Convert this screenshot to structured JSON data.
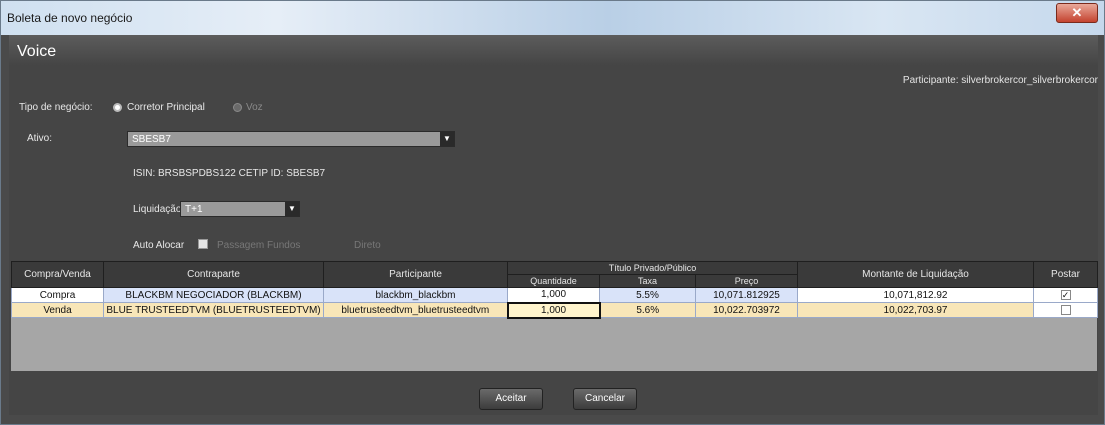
{
  "window": {
    "title": "Boleta de novo negócio",
    "close_glyph": "✕"
  },
  "header": {
    "title": "Voice",
    "participant": "Participante: silverbrokercor_silverbrokercor"
  },
  "form": {
    "deal_type_label": "Tipo de negócio:",
    "deal_type_options": [
      "Corretor Principal",
      "Voz"
    ],
    "deal_type_selected": "Corretor Principal",
    "asset_label": "Ativo:",
    "asset_value": "SBESB7",
    "isin": "ISIN:  BRSBSPDBS122   CETIP ID: SBESB7",
    "settlement_label": "Liquidação:",
    "settlement_value": "T+1",
    "auto_allocate_label": "Auto Alocar",
    "passagem_label": "Passagem Fundos",
    "direto_label": "Direto"
  },
  "table": {
    "headers": {
      "side": "Compra/Venda",
      "counterparty": "Contraparte",
      "participant": "Participante",
      "group": "Título Privado/Público",
      "quantity": "Quantidade",
      "rate": "Taxa",
      "price": "Preço",
      "amount": "Montante de Liquidação",
      "post": "Postar"
    },
    "rows": [
      {
        "side": "Compra",
        "counterparty": "BLACKBM NEGOCIADOR (BLACKBM)",
        "participant": "blackbm_blackbm",
        "quantity": "1,000",
        "rate": "5.5%",
        "price": "10,071.812925",
        "amount": "10,071,812.92",
        "post": "✓"
      },
      {
        "side": "Venda",
        "counterparty": "BLUE TRUSTEEDTVM (BLUETRUSTEEDTVM)",
        "participant": "bluetrusteedtvm_bluetrusteedtvm",
        "quantity": "1,000",
        "rate": "5.6%",
        "price": "10,022.703972",
        "amount": "10,022,703.97",
        "post": ""
      }
    ]
  },
  "footer": {
    "accept": "Aceitar",
    "cancel": "Cancelar"
  },
  "icons": {
    "dropdown": "▼"
  }
}
